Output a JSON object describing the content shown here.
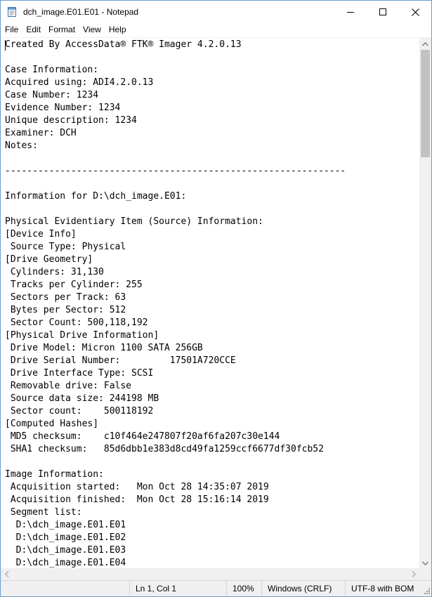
{
  "window": {
    "title": "dch_image.E01.E01 - Notepad",
    "icons": {
      "app": "notepad-icon",
      "minimize": "minimize-icon",
      "maximize": "maximize-icon",
      "close": "close-icon"
    }
  },
  "menu": [
    {
      "id": "file",
      "label": "File"
    },
    {
      "id": "edit",
      "label": "Edit"
    },
    {
      "id": "format",
      "label": "Format"
    },
    {
      "id": "view",
      "label": "View"
    },
    {
      "id": "help",
      "label": "Help"
    }
  ],
  "document": {
    "lines": [
      "Created By AccessData® FTK® Imager 4.2.0.13",
      "",
      "Case Information:",
      "Acquired using: ADI4.2.0.13",
      "Case Number: 1234",
      "Evidence Number: 1234",
      "Unique description: 1234",
      "Examiner: DCH",
      "Notes:",
      "",
      "--------------------------------------------------------------",
      "",
      "Information for D:\\dch_image.E01:",
      "",
      "Physical Evidentiary Item (Source) Information:",
      "[Device Info]",
      " Source Type: Physical",
      "[Drive Geometry]",
      " Cylinders: 31,130",
      " Tracks per Cylinder: 255",
      " Sectors per Track: 63",
      " Bytes per Sector: 512",
      " Sector Count: 500,118,192",
      "[Physical Drive Information]",
      " Drive Model: Micron 1100 SATA 256GB",
      " Drive Serial Number:         17501A720CCE",
      " Drive Interface Type: SCSI",
      " Removable drive: False",
      " Source data size: 244198 MB",
      " Sector count:    500118192",
      "[Computed Hashes]",
      " MD5 checksum:    c10f464e247807f20af6fa207c30e144",
      " SHA1 checksum:   85d6dbb1e383d8cd49fa1259ccf6677df30fcb52",
      "",
      "Image Information:",
      " Acquisition started:   Mon Oct 28 14:35:07 2019",
      " Acquisition finished:  Mon Oct 28 15:16:14 2019",
      " Segment list:",
      "  D:\\dch_image.E01.E01",
      "  D:\\dch_image.E01.E02",
      "  D:\\dch_image.E01.E03",
      "  D:\\dch_image.E01.E04"
    ]
  },
  "status_bar": {
    "position": "Ln 1, Col 1",
    "zoom": "100%",
    "line_endings": "Windows (CRLF)",
    "encoding": "UTF-8 with BOM"
  },
  "scrollbar": {
    "vertical_position": 0,
    "icons": {
      "up": "scroll-up-arrow-icon",
      "down": "scroll-down-arrow-icon",
      "left": "scroll-left-arrow-icon",
      "right": "scroll-right-arrow-icon"
    }
  },
  "colors": {
    "window_border": "#6f9bd1",
    "chrome": "#f0f0f0",
    "scroll_thumb": "#c2c2c2",
    "text": "#000000"
  }
}
